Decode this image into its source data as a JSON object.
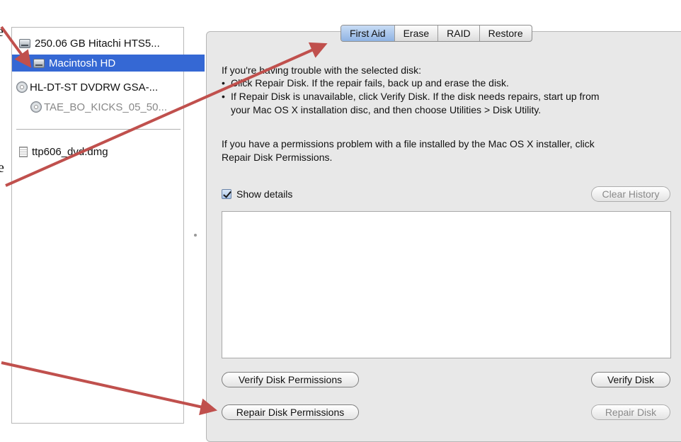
{
  "stray_text": {
    "upper": "e",
    "lower": "e"
  },
  "sidebar": {
    "items": [
      {
        "label": "250.06 GB Hitachi HTS5...",
        "icon": "hard-disk-icon"
      },
      {
        "label": "Macintosh HD",
        "icon": "volume-icon"
      },
      {
        "label": "HL-DT-ST DVDRW GSA-...",
        "icon": "optical-drive-icon"
      },
      {
        "label": "TAE_BO_KICKS_05_50...",
        "icon": "cd-icon"
      },
      {
        "label": "ttp606_dvd.dmg",
        "icon": "document-icon"
      }
    ]
  },
  "tabs": [
    {
      "label": "First Aid",
      "active": true
    },
    {
      "label": "Erase",
      "active": false
    },
    {
      "label": "RAID",
      "active": false
    },
    {
      "label": "Restore",
      "active": false
    }
  ],
  "first_aid": {
    "intro": "If you're having trouble with the selected disk:",
    "bullet_1": "Click Repair Disk. If the repair fails, back up and erase the disk.",
    "bullet_2_line_1": "If Repair Disk is unavailable, click Verify Disk. If the disk needs repairs, start up from",
    "bullet_2_line_2": "your Mac OS X installation disc, and then choose Utilities > Disk Utility.",
    "permissions_line_1": "If you have a permissions problem with a file installed by the Mac OS X installer, click",
    "permissions_line_2": "Repair Disk Permissions.",
    "show_details_label": "Show details",
    "show_details_checked": true,
    "clear_history_label": "Clear History",
    "verify_permissions_label": "Verify Disk Permissions",
    "verify_disk_label": "Verify Disk",
    "repair_permissions_label": "Repair Disk Permissions",
    "repair_disk_label": "Repair Disk"
  },
  "colors": {
    "selection": "#3568d4",
    "arrow": "#c0504d",
    "active_tab": "#a9c6ee"
  }
}
